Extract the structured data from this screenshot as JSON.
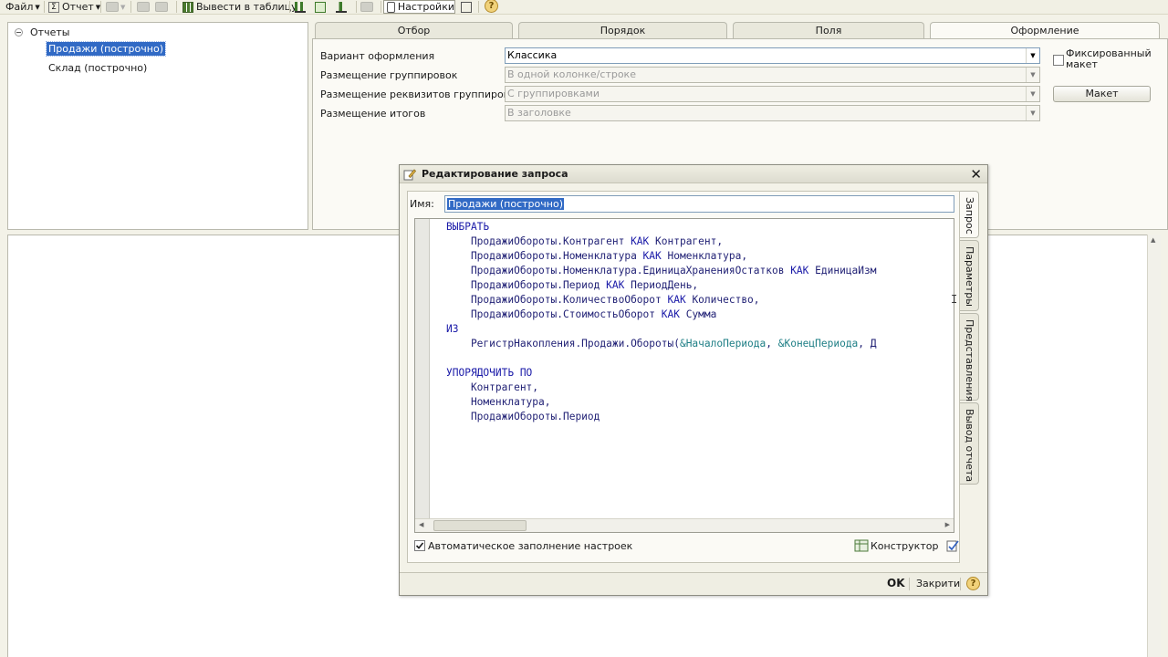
{
  "toolbar": {
    "file_label": "Файл",
    "report_label": "Отчет",
    "to_table_label": "Вывести в таблицу",
    "settings_label": "Настройки",
    "help_label": "?"
  },
  "tree": {
    "root_label": "Отчеты",
    "items": [
      {
        "label": "Продажи (построчно)"
      },
      {
        "label": "Склад (построчно)"
      }
    ]
  },
  "settings_tabs": [
    "Отбор",
    "Порядок",
    "Поля",
    "Оформление"
  ],
  "layout": {
    "fields": [
      {
        "label": "Вариант оформления",
        "value": "Классика"
      },
      {
        "label": "Размещение группировок",
        "value": "В одной колонке/строке"
      },
      {
        "label": "Размещение реквизитов группировок",
        "value": "С группировками"
      },
      {
        "label": "Размещение итогов",
        "value": "В заголовке"
      }
    ],
    "fixed_layout_label": "Фиксированный макет",
    "maket_button": "Макет"
  },
  "dialog": {
    "title": "Редактирование запроса",
    "close": "✕",
    "name_label": "Имя:",
    "name_value": "Продажи (построчно)",
    "side_tabs": [
      "Запрос",
      "Параметры",
      "Представления",
      "Вывод отчета"
    ],
    "code_lines": [
      "ВЫБРАТЬ",
      "    ПродажиОбороты.Контрагент КАК Контрагент,",
      "    ПродажиОбороты.Номенклатура КАК Номенклатура,",
      "    ПродажиОбороты.Номенклатура.ЕдиницаХраненияОстатков КАК ЕдиницаИзм",
      "    ПродажиОбороты.Период КАК ПериодДень,",
      "    ПродажиОбороты.КоличествоОборот КАК Количество,",
      "    ПродажиОбороты.СтоимостьОборот КАК Сумма",
      "ИЗ",
      "    РегистрНакопления.Продажи.Обороты(&НачалоПериода, &КонецПериода, Д",
      "",
      "УПОРЯДОЧИТЬ ПО",
      "    Контрагент,",
      "    Номенклатура,",
      "    ПродажиОбороты.Период"
    ],
    "auto_fill_label": "Автоматическое заполнение настроек",
    "constructor_label": "Конструктор",
    "ok_label": "OK",
    "close_label": "Закрити",
    "help_label": "?"
  }
}
